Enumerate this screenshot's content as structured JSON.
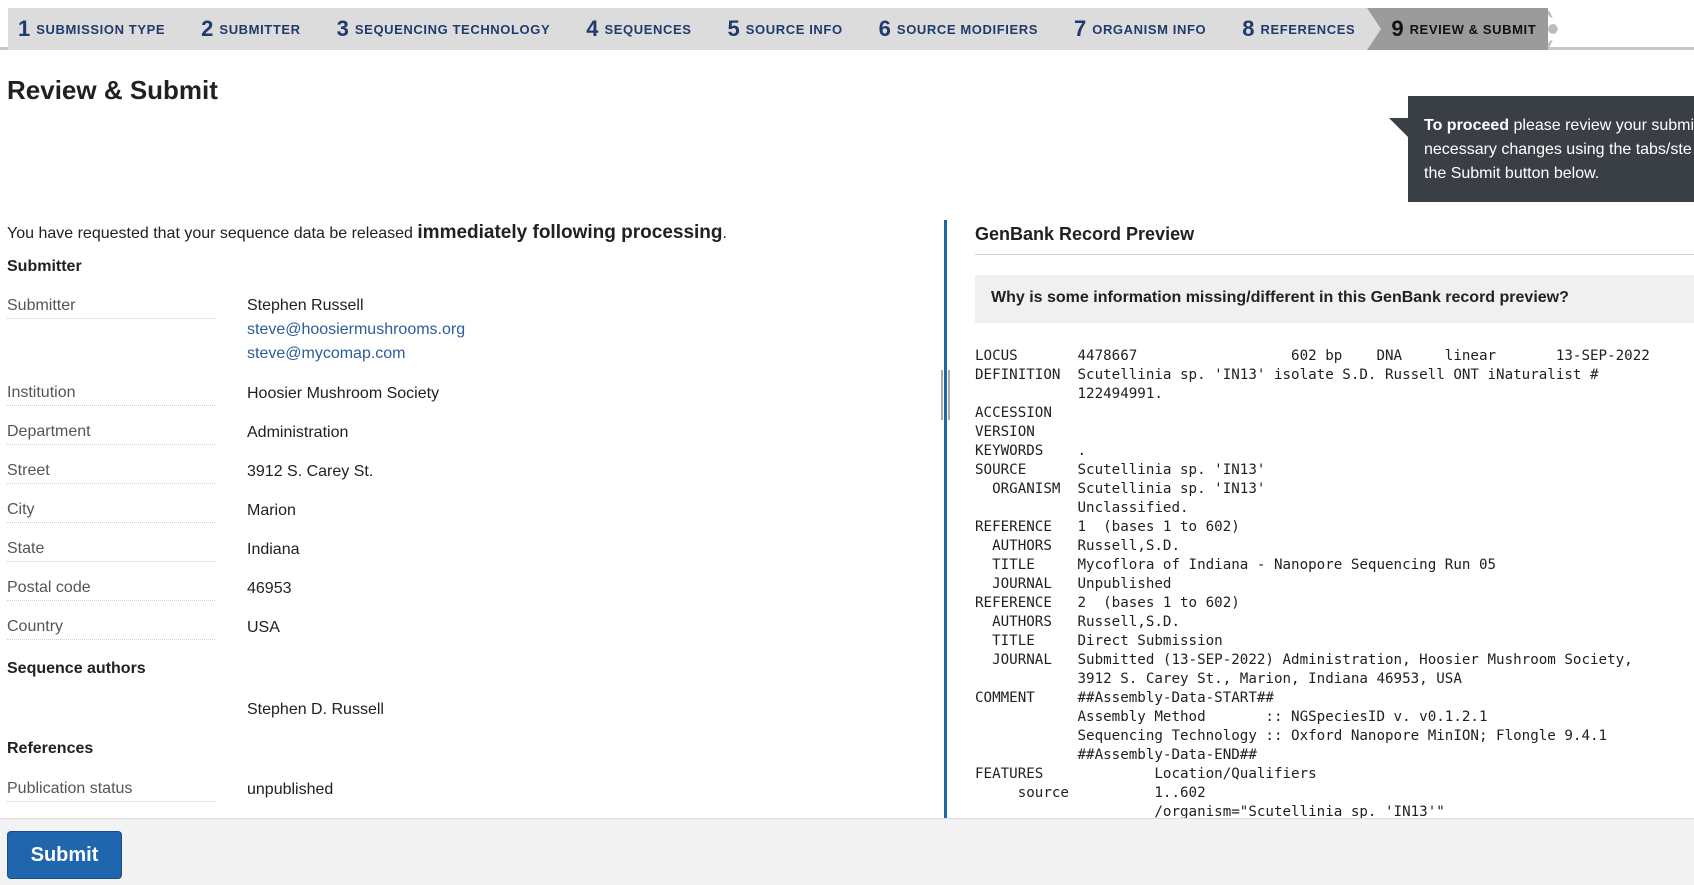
{
  "steps": [
    {
      "num": "1",
      "label": "Submission Type"
    },
    {
      "num": "2",
      "label": "Submitter"
    },
    {
      "num": "3",
      "label": "Sequencing Technology"
    },
    {
      "num": "4",
      "label": "Sequences"
    },
    {
      "num": "5",
      "label": "Source Info"
    },
    {
      "num": "6",
      "label": "Source Modifiers"
    },
    {
      "num": "7",
      "label": "Organism Info"
    },
    {
      "num": "8",
      "label": "References"
    },
    {
      "num": "9",
      "label": "Review & Submit"
    }
  ],
  "page_title": "Review & Submit",
  "callout": {
    "bold": "To proceed",
    "line1": " please review your submis",
    "line2": "necessary changes using the tabs/ste",
    "line3": "the Submit button below."
  },
  "release": {
    "prefix": "You have requested that your sequence data be released ",
    "emphasis": "immediately following processing",
    "suffix": "."
  },
  "submitter_section": {
    "heading": "Submitter",
    "submitter_label": "Submitter",
    "submitter_name": "Stephen Russell",
    "email1": "steve@hoosiermushrooms.org",
    "email2": "steve@mycomap.com",
    "institution_label": "Institution",
    "institution": "Hoosier Mushroom Society",
    "department_label": "Department",
    "department": "Administration",
    "street_label": "Street",
    "street": "3912 S. Carey St.",
    "city_label": "City",
    "city": "Marion",
    "state_label": "State",
    "state": "Indiana",
    "postal_label": "Postal code",
    "postal": "46953",
    "country_label": "Country",
    "country": "USA"
  },
  "authors_section": {
    "heading": "Sequence authors",
    "author": "Stephen D. Russell"
  },
  "references_section": {
    "heading": "References",
    "pub_status_label": "Publication status",
    "pub_status": "unpublished"
  },
  "preview": {
    "title": "GenBank Record Preview",
    "faq": "Why is some information missing/different in this GenBank record preview?",
    "record_lines": [
      "LOCUS       4478667                  602 bp    DNA     linear       13-SEP-2022",
      "DEFINITION  Scutellinia sp. 'IN13' isolate S.D. Russell ONT iNaturalist #",
      "            122494991.",
      "ACCESSION",
      "VERSION",
      "KEYWORDS    .",
      "SOURCE      Scutellinia sp. 'IN13'",
      "  ORGANISM  Scutellinia sp. 'IN13'",
      "            Unclassified.",
      "REFERENCE   1  (bases 1 to 602)",
      "  AUTHORS   Russell,S.D.",
      "  TITLE     Mycoflora of Indiana - Nanopore Sequencing Run 05",
      "  JOURNAL   Unpublished",
      "REFERENCE   2  (bases 1 to 602)",
      "  AUTHORS   Russell,S.D.",
      "  TITLE     Direct Submission",
      "  JOURNAL   Submitted (13-SEP-2022) Administration, Hoosier Mushroom Society,",
      "            3912 S. Carey St., Marion, Indiana 46953, USA",
      "COMMENT     ##Assembly-Data-START##",
      "            Assembly Method       :: NGSpeciesID v. v0.1.2.1",
      "            Sequencing Technology :: Oxford Nanopore MinION; Flongle 9.4.1",
      "            ##Assembly-Data-END##",
      "FEATURES             Location/Qualifiers",
      "     source          1..602",
      "                     /organism=\"Scutellinia sp. 'IN13'\""
    ]
  },
  "submit_label": "Submit"
}
